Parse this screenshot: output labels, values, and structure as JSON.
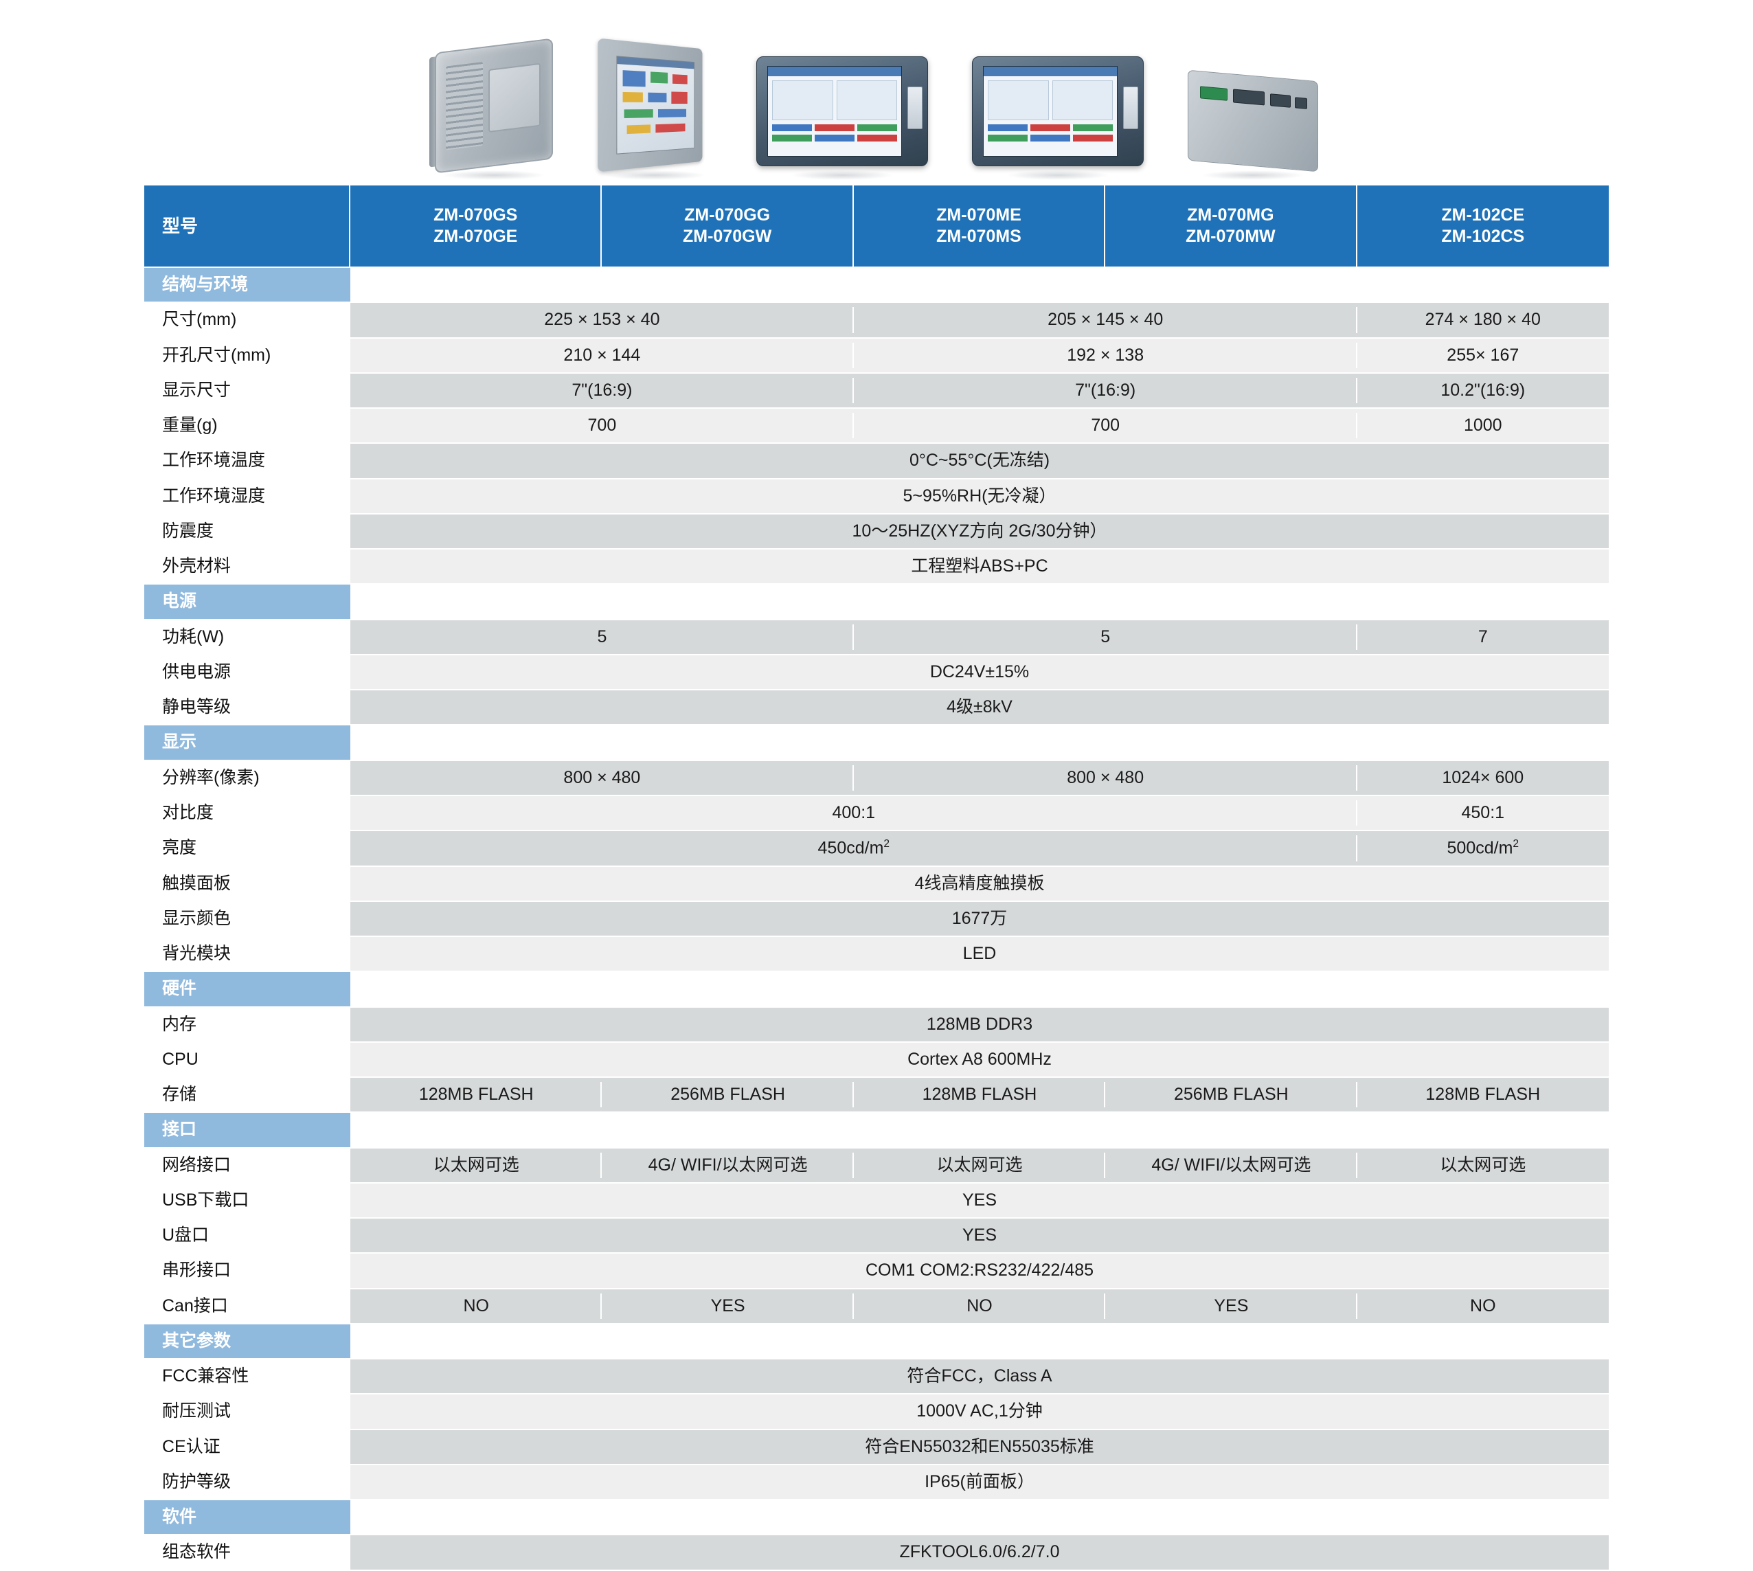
{
  "meta": {
    "accent_blue": "#1f72b8",
    "section_blue": "#8fb9dd",
    "row_shade": "#d6d9da",
    "row_plain": "#efefef"
  },
  "hero": {
    "devices": [
      {
        "name": "hmi-rear-three-quarter-grey"
      },
      {
        "name": "hmi-left-three-quarter-screen"
      },
      {
        "name": "hmi-front-7inch-a"
      },
      {
        "name": "hmi-front-7inch-b"
      },
      {
        "name": "hmi-rear-ports"
      }
    ]
  },
  "header": {
    "label": "型号",
    "columns": [
      {
        "line1": "ZM-070GS",
        "line2": "ZM-070GE"
      },
      {
        "line1": "ZM-070GG",
        "line2": "ZM-070GW"
      },
      {
        "line1": "ZM-070ME",
        "line2": "ZM-070MS"
      },
      {
        "line1": "ZM-070MG",
        "line2": "ZM-070MW"
      },
      {
        "line1": "ZM-102CE",
        "line2": "ZM-102CS"
      }
    ]
  },
  "sections": [
    {
      "title": "结构与环境",
      "rows": [
        {
          "label": "尺寸(mm)",
          "cells": [
            {
              "text": "225 × 153 × 40",
              "span": 2
            },
            {
              "text": "205 × 145 × 40",
              "span": 2
            },
            {
              "text": "274 × 180 × 40",
              "span": 1
            }
          ]
        },
        {
          "label": "开孔尺寸(mm)",
          "cells": [
            {
              "text": "210 × 144",
              "span": 2
            },
            {
              "text": "192 × 138",
              "span": 2
            },
            {
              "text": "255× 167",
              "span": 1
            }
          ]
        },
        {
          "label": "显示尺寸",
          "cells": [
            {
              "text": "7\"(16:9)",
              "span": 2
            },
            {
              "text": "7\"(16:9)",
              "span": 2
            },
            {
              "text": "10.2\"(16:9)",
              "span": 1
            }
          ]
        },
        {
          "label": "重量(g)",
          "cells": [
            {
              "text": "700",
              "span": 2
            },
            {
              "text": "700",
              "span": 2
            },
            {
              "text": "1000",
              "span": 1
            }
          ]
        },
        {
          "label": "工作环境温度",
          "cells": [
            {
              "text": "0°C~55°C(无冻结)",
              "span": 5
            }
          ]
        },
        {
          "label": "工作环境湿度",
          "cells": [
            {
              "text": "5~95%RH(无冷凝）",
              "span": 5
            }
          ]
        },
        {
          "label": "防震度",
          "cells": [
            {
              "text": "10～25HZ(XYZ方向 2G/30分钟）",
              "span": 5
            }
          ]
        },
        {
          "label": "外壳材料",
          "cells": [
            {
              "text": "工程塑料ABS+PC",
              "span": 5
            }
          ]
        }
      ]
    },
    {
      "title": "电源",
      "rows": [
        {
          "label": "功耗(W)",
          "cells": [
            {
              "text": "5",
              "span": 2
            },
            {
              "text": "5",
              "span": 2
            },
            {
              "text": "7",
              "span": 1
            }
          ]
        },
        {
          "label": "供电电源",
          "cells": [
            {
              "text": "DC24V±15%",
              "span": 5
            }
          ]
        },
        {
          "label": "静电等级",
          "cells": [
            {
              "text": "4级±8kV",
              "span": 5
            }
          ]
        }
      ]
    },
    {
      "title": "显示",
      "rows": [
        {
          "label": "分辨率(像素)",
          "cells": [
            {
              "text": "800 × 480",
              "span": 2
            },
            {
              "text": "800 × 480",
              "span": 2
            },
            {
              "text": "1024× 600",
              "span": 1
            }
          ]
        },
        {
          "label": "对比度",
          "cells": [
            {
              "text": "400:1",
              "span": 4
            },
            {
              "text": "450:1",
              "span": 1
            }
          ]
        },
        {
          "label": "亮度",
          "cells": [
            {
              "html": "450cd/m<sup>2</sup>",
              "span": 4
            },
            {
              "html": "500cd/m<sup>2</sup>",
              "span": 1
            }
          ]
        },
        {
          "label": "触摸面板",
          "cells": [
            {
              "text": "4线高精度触摸板",
              "span": 5
            }
          ]
        },
        {
          "label": "显示颜色",
          "cells": [
            {
              "text": "1677万",
              "span": 5
            }
          ]
        },
        {
          "label": "背光模块",
          "cells": [
            {
              "text": "LED",
              "span": 5
            }
          ]
        }
      ]
    },
    {
      "title": "硬件",
      "rows": [
        {
          "label": "内存",
          "cells": [
            {
              "text": "128MB DDR3",
              "span": 5
            }
          ]
        },
        {
          "label": "CPU",
          "cells": [
            {
              "text": "Cortex A8 600MHz",
              "span": 5
            }
          ]
        },
        {
          "label": "存储",
          "cells": [
            {
              "text": "128MB FLASH",
              "span": 1
            },
            {
              "text": "256MB FLASH",
              "span": 1
            },
            {
              "text": "128MB FLASH",
              "span": 1
            },
            {
              "text": "256MB FLASH",
              "span": 1
            },
            {
              "text": "128MB FLASH",
              "span": 1
            }
          ]
        }
      ]
    },
    {
      "title": "接口",
      "rows": [
        {
          "label": "网络接口",
          "cells": [
            {
              "text": "以太网可选",
              "span": 1
            },
            {
              "text": "4G/ WIFI/以太网可选",
              "span": 1
            },
            {
              "text": "以太网可选",
              "span": 1
            },
            {
              "text": "4G/ WIFI/以太网可选",
              "span": 1
            },
            {
              "text": "以太网可选",
              "span": 1
            }
          ]
        },
        {
          "label": "USB下载口",
          "cells": [
            {
              "text": "YES",
              "span": 5
            }
          ]
        },
        {
          "label": "U盘口",
          "cells": [
            {
              "text": "YES",
              "span": 5
            }
          ]
        },
        {
          "label": "串形接口",
          "cells": [
            {
              "text": "COM1  COM2:RS232/422/485",
              "span": 5
            }
          ]
        },
        {
          "label": "Can接口",
          "cells": [
            {
              "text": "NO",
              "span": 1
            },
            {
              "text": "YES",
              "span": 1
            },
            {
              "text": "NO",
              "span": 1
            },
            {
              "text": "YES",
              "span": 1
            },
            {
              "text": "NO",
              "span": 1
            }
          ]
        }
      ]
    },
    {
      "title": "其它参数",
      "rows": [
        {
          "label": "FCC兼容性",
          "cells": [
            {
              "text": "符合FCC，Class A",
              "span": 5
            }
          ]
        },
        {
          "label": "耐压测试",
          "cells": [
            {
              "text": "1000V AC,1分钟",
              "span": 5
            }
          ]
        },
        {
          "label": "CE认证",
          "cells": [
            {
              "text": "符合EN55032和EN55035标准",
              "span": 5
            }
          ]
        },
        {
          "label": "防护等级",
          "cells": [
            {
              "text": "IP65(前面板）",
              "span": 5
            }
          ]
        }
      ]
    },
    {
      "title": "软件",
      "rows": [
        {
          "label": "组态软件",
          "cells": [
            {
              "text": "ZFKTOOL6.0/6.2/7.0",
              "span": 5
            }
          ]
        }
      ]
    }
  ]
}
